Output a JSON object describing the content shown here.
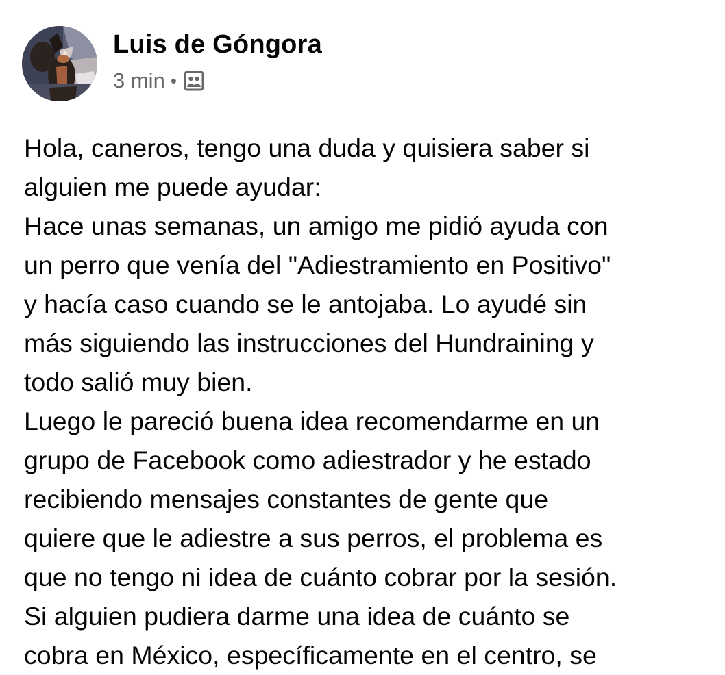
{
  "post": {
    "author": {
      "name": "Luis de Góngora",
      "avatar_icon": "dog-photo-avatar"
    },
    "meta": {
      "timestamp": "3 min",
      "separator": "•",
      "privacy_icon": "group-members-icon"
    },
    "lines": [
      "Hola, caneros, tengo una duda y quisiera saber si",
      "alguien me puede ayudar:",
      "Hace unas semanas, un amigo me pidió ayuda con",
      "un perro que venía del \"Adiestramiento en Positivo\"",
      "y hacía caso cuando se le antojaba. Lo ayudé sin",
      "más siguiendo las instrucciones del Hundraining y",
      "todo salió muy bien.",
      "Luego le pareció buena idea recomendarme en un",
      "grupo de Facebook como adiestrador y he estado",
      "recibiendo mensajes constantes de gente que",
      "quiere que le adiestre a sus perros, el problema es",
      "que no tengo ni idea de cuánto cobrar por la sesión.",
      "Si alguien pudiera darme una idea de cuánto se",
      "cobra en México, específicamente en el centro, se"
    ]
  },
  "colors": {
    "text_primary": "#050505",
    "text_secondary": "#65676b",
    "background": "#ffffff"
  }
}
